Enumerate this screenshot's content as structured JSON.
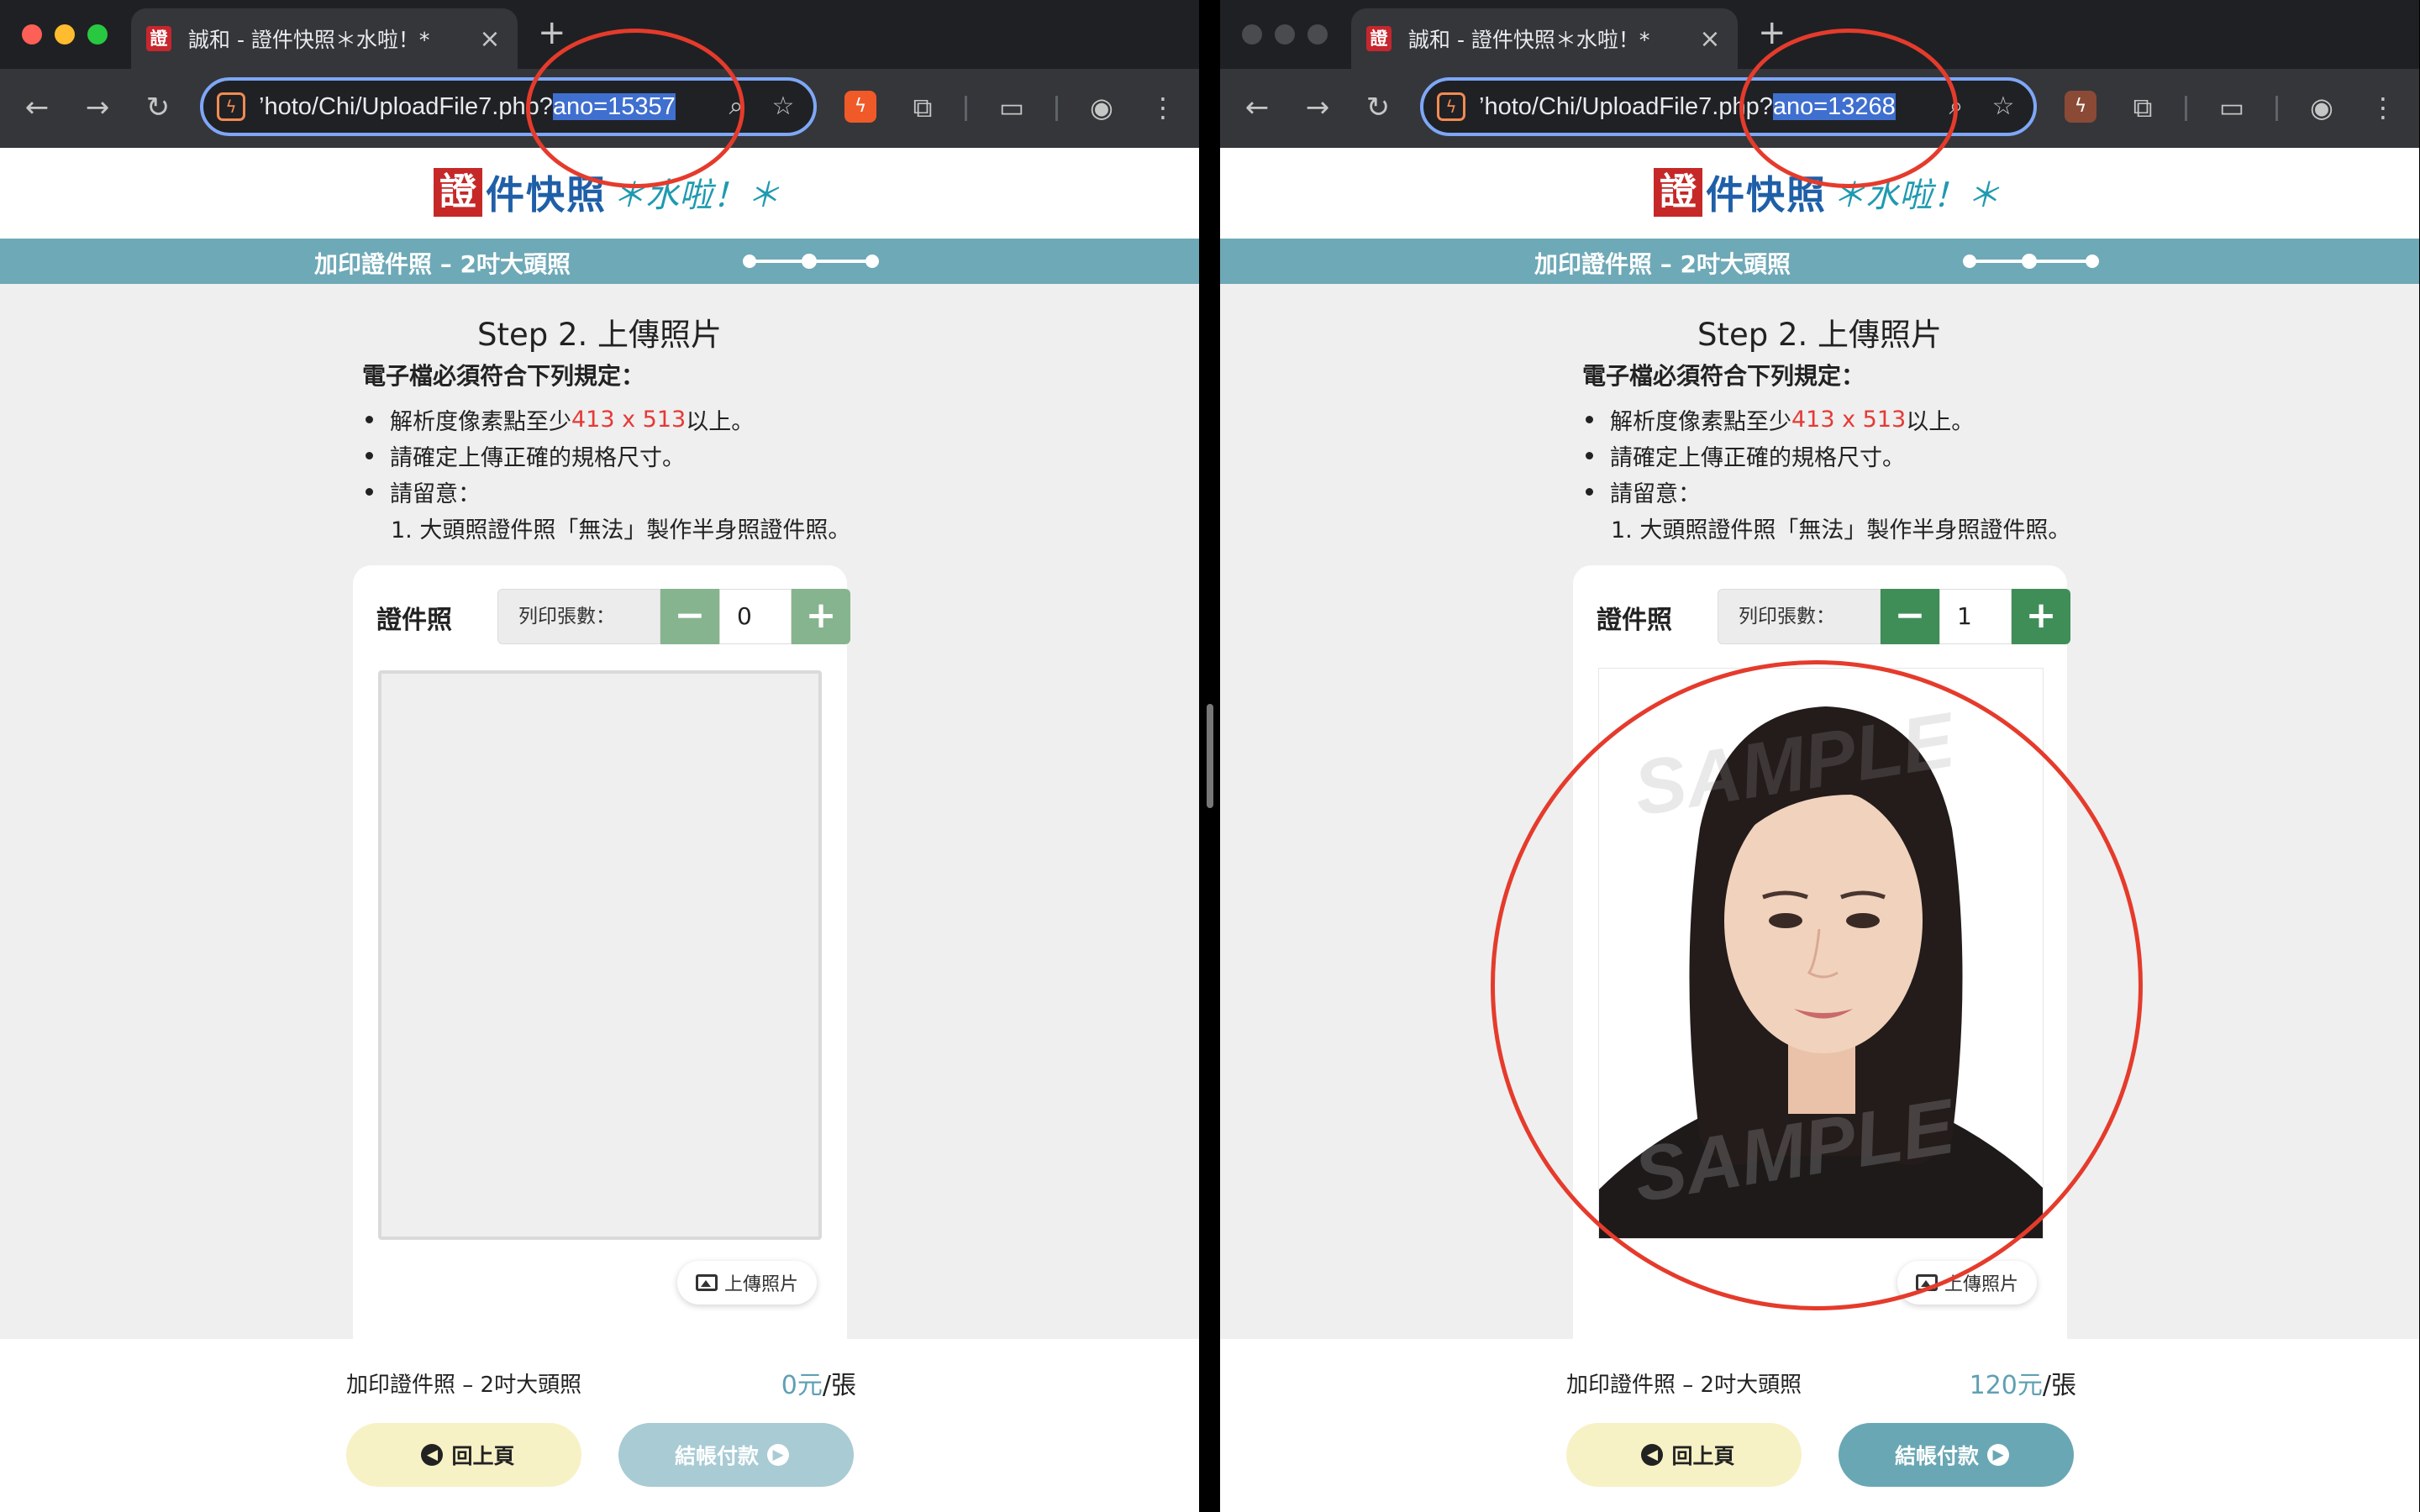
{
  "browser": {
    "tab_title": "誠和 - 證件快照＊水啦！*",
    "favicon_char": "證",
    "new_tab": "+",
    "tab_close": "×",
    "url_prefix": "’hoto/Chi/UploadFile7.php?"
  },
  "windows": [
    {
      "url_query": "ano=15357",
      "quantity": "0",
      "price_value": "0元",
      "has_photo": false,
      "minus_color": "#86b48e",
      "plus_color": "#86b48e",
      "next_color": "#a8cbd4",
      "controls_dim": false
    },
    {
      "url_query": "ano=13268",
      "quantity": "1",
      "price_value": "120元",
      "has_photo": true,
      "minus_color": "#3f8e58",
      "plus_color": "#3f8e58",
      "next_color": "#6aa7b4",
      "controls_dim": true
    }
  ],
  "icons": {
    "back": "back-arrow-icon",
    "forward": "forward-arrow-icon",
    "reload": "reload-icon",
    "site": "site-info-icon",
    "zoom": "zoom-icon",
    "bookmark": "star-icon",
    "extension": "puzzle-icon",
    "media": "media-search-icon",
    "profile": "profile-icon",
    "menu": "kebab-menu-icon"
  },
  "header": {
    "logo_box": "證",
    "logo_text": "件快照",
    "logo_sub": "＊水啦！＊"
  },
  "banner": {
    "title": "加印證件照 – 2吋大頭照"
  },
  "content": {
    "step_title": "Step 2. 上傳照片",
    "req_head": "電子檔必須符合下列規定：",
    "req1_prefix": "解析度像素點至少 ",
    "req1_highlight": "413 x 513",
    "req1_suffix": " 以上。",
    "req2": "請確定上傳正確的規格尺寸。",
    "req3": "請留意：",
    "req3_sub": "1. 大頭照證件照「無法」製作半身照證件照。"
  },
  "card": {
    "title": "證件照",
    "qty_label": "列印張數：",
    "minus": "−",
    "plus": "+",
    "upload_label": "上傳照片",
    "watermark": "SAMPLE"
  },
  "footer": {
    "product_name": "加印證件照 – 2吋大頭照",
    "price_unit": "/張",
    "back_label": "回上頁",
    "next_label": "結帳付款"
  },
  "colors": {
    "banner": "#6ea9b7",
    "price_accent": "#5fa0b3",
    "annotation_red": "#e53b2c"
  }
}
